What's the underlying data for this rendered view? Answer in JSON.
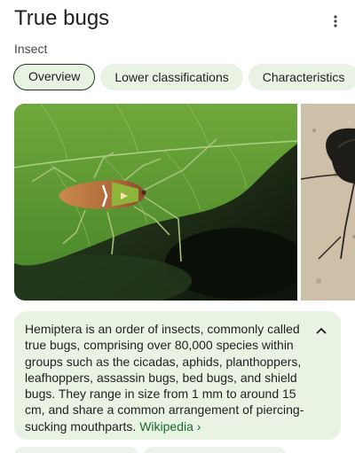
{
  "header": {
    "title": "True bugs",
    "subtitle": "Insect",
    "menu_icon": "more-vert-icon"
  },
  "tabs": [
    {
      "label": "Overview",
      "active": true
    },
    {
      "label": "Lower classifications",
      "active": false
    },
    {
      "label": "Characteristics",
      "active": false
    }
  ],
  "description": {
    "text": "Hemiptera is an order of insects, commonly called true bugs, comprising over 80,000 species within groups such as the cicadas, aphids, planthoppers, leafhoppers, assassin bugs, bed bugs, and shield bugs. They range in size from 1 mm to around 15 cm, and share a common arrangement of piercing-sucking mouthparts.",
    "source": "Wikipedia",
    "source_arrow": "›",
    "collapse_icon": "chevron-up-icon"
  },
  "colors": {
    "chip_bg": "#e9f3e4",
    "chip_border_active": "#1f3a1f",
    "card_bg": "#e9f3e4",
    "link": "#1a6a2c"
  }
}
